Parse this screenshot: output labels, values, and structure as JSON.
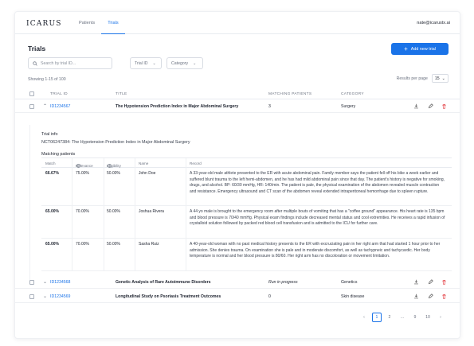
{
  "app": {
    "logo": "ICARUS",
    "user_email": "nate@icarustx.ai"
  },
  "nav": [
    {
      "label": "Patients"
    },
    {
      "label": "Trials"
    }
  ],
  "page": {
    "title": "Trials",
    "add_button": "Add new trial"
  },
  "search": {
    "placeholder": "Search by trial ID..."
  },
  "filters": [
    {
      "label": "Trial ID"
    },
    {
      "label": "Category"
    }
  ],
  "showing": "Showing 1-15 of 100",
  "rows_per_page": {
    "label": "Results per page",
    "value": "15"
  },
  "table": {
    "headers": {
      "trial_id": "TRIAL ID",
      "title": "TITLE",
      "matching": "MATCHING PATIENTS",
      "category": "CATEGORY"
    },
    "rows": [
      {
        "id": "ID1234567",
        "title": "The Hypotension Prediction Index in Major Abdominal Surgery",
        "matching": "3",
        "category": "Surgery"
      },
      {
        "id": "ID1234568",
        "title": "Genetic Analysis of Rare Autoimmune Disorders",
        "matching": "Run in progress",
        "category": "Genetics"
      },
      {
        "id": "ID1234569",
        "title": "Longitudinal Study on Psoriasis Treatment Outcomes",
        "matching": "0",
        "category": "Skin disease"
      }
    ]
  },
  "detail": {
    "info_heading": "Trial info",
    "info_text": "NCT06247384: The Hypotension Prediction Index in Major Abdominal Surgery",
    "matching_heading": "Matching patients",
    "columns": {
      "match": "Match",
      "relevance": "Relevance",
      "eligibility": "Eligibility",
      "name": "Name",
      "record": "Record"
    },
    "patients": [
      {
        "match": "66.67%",
        "relevance": "75.00%",
        "eligibility": "50.00%",
        "name": "John Doe",
        "record": "A 33-year-old male athlete presented to the ER with acute abdominal pain. Family member says the patient fell off his bike a week earlier and suffered blunt trauma to the left hemi-abdomen, and he has had mild abdominal pain since that day. The patient's history is negative for smoking, drugs, and alcohol. BP: 60/30 mmHg, HR: 140/min. The patient is pale, the physical examination of the abdomen revealed muscle contraction and resistance. Emergency ultrasound and CT scan of the abdomen reveal extended intraperitoneal hemorrhage due to spleen rupture."
      },
      {
        "match": "65.00%",
        "relevance": "70.00%",
        "eligibility": "50.00%",
        "name": "Joshua Rivera",
        "record": "A 44 yo male is brought to the emergency room after multiple bouts of vomiting that has a \"coffee ground\" appearance. His heart rate is 135 bpm and blood pressure is 70/40 mmHg. Physical exam findings include decreased mental status and cool extremities. He receives a rapid infusion of crystalloid solution followed by packed red blood cell transfusion and is admitted to the ICU for further care."
      },
      {
        "match": "65.00%",
        "relevance": "70.00%",
        "eligibility": "50.00%",
        "name": "Sasha Ruiz",
        "record": "A 40-year-old woman with no past medical history presents to the ER with excruciating pain in her right arm that had started 1 hour prior to her admission. She denies trauma. On examination she is pale and in moderate discomfort, as well as tachypneic and tachycardic. Her body temperature is normal and her blood pressure is 80/60. Her right arm has no discoloration or movement limitation."
      }
    ]
  },
  "pagination": {
    "pages": [
      "1",
      "2",
      "...",
      "9",
      "10"
    ],
    "active": "1"
  },
  "colors": {
    "accent": "#1a73e8",
    "danger": "#e5484d"
  },
  "icons": [
    "search-icon",
    "chevron-down-icon",
    "plus-icon",
    "download-icon",
    "edit-icon",
    "trash-icon",
    "info-icon",
    "chevron-left-icon",
    "chevron-right-icon"
  ]
}
